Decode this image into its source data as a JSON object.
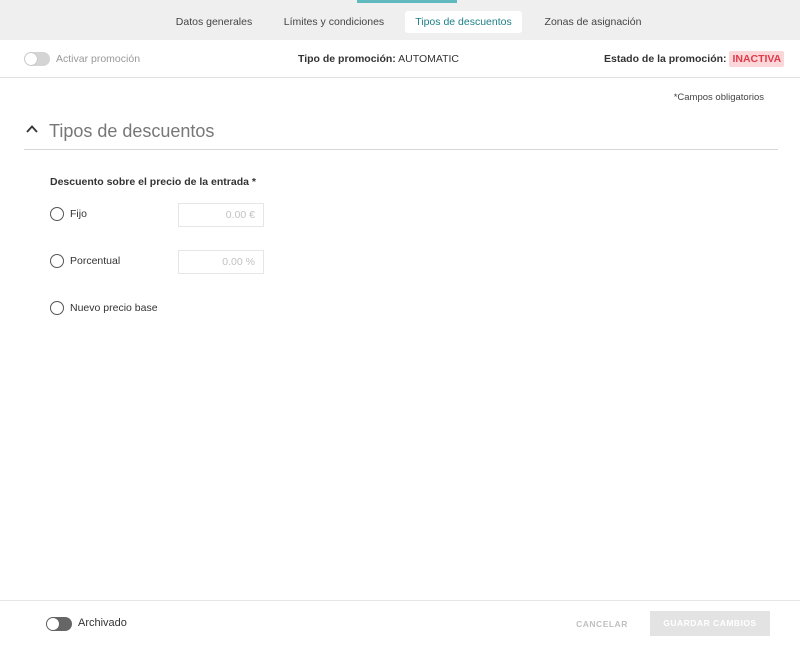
{
  "tabs": [
    {
      "label": "Datos generales",
      "active": false
    },
    {
      "label": "Límites y condiciones",
      "active": false
    },
    {
      "label": "Tipos de descuentos",
      "active": true
    },
    {
      "label": "Zonas de asignación",
      "active": false
    }
  ],
  "status": {
    "activate_label": "Activar promoción",
    "activate_on": false,
    "type_label": "Tipo de promoción:",
    "type_value": "AUTOMATIC",
    "state_label": "Estado de la promoción:",
    "state_value": "INACTIVA"
  },
  "required_note": "*Campos obligatorios",
  "section": {
    "title": "Tipos de descuentos",
    "expanded": true,
    "icon": "chevron-up-icon"
  },
  "discount": {
    "group_label": "Descuento sobre el precio de la entrada *",
    "options": [
      {
        "label": "Fijo",
        "placeholder": "0.00 €",
        "selected": false
      },
      {
        "label": "Porcentual",
        "placeholder": "0.00 %",
        "selected": false
      },
      {
        "label": "Nuevo precio base",
        "selected": false
      }
    ]
  },
  "footer": {
    "archived_label": "Archivado",
    "archived_on": false,
    "cancel_label": "CANCELAR",
    "save_label": "GUARDAR CAMBIOS"
  },
  "colors": {
    "accent": "#1d7f86",
    "tab_indicator": "#5fb9bf",
    "inactive_badge_bg": "#fbd7d9",
    "inactive_badge_text": "#e03a4b"
  }
}
